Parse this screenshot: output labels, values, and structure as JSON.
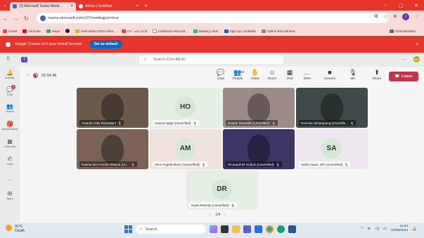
{
  "browser": {
    "tabs": [
      {
        "label": "(3) Microsoft Teams Meeti...",
        "active": true
      },
      {
        "label": "Admin | SertiNaxi",
        "active": false
      }
    ],
    "url": "teams.microsoft.com/v2/?meetingjoin=true",
    "bookmarks": [
      "Gmail",
      "YouTube",
      "Maps",
      "Rekrutmen SSDI Infos...",
      "CV - vcc.co.id",
      "Indofood e-Recruit...",
      "Mading Loker",
      "Sign Up | LinkedIn",
      "Online Recruitment..."
    ],
    "all_bookmarks": "All Bookmarks",
    "notice_text": "Google Chrome isn't your default browser",
    "notice_button": "Set as default"
  },
  "teams": {
    "search_placeholder": "Search (Ctrl+Alt+E)",
    "rail": [
      {
        "label": "Activity"
      },
      {
        "label": "Chat",
        "badge": "3"
      },
      {
        "label": "Teams"
      },
      {
        "label": "Assignments"
      },
      {
        "label": "Calendar"
      },
      {
        "label": "Calls"
      },
      {
        "label": "..."
      },
      {
        "label": "Apps"
      }
    ],
    "meeting": {
      "timer": "02:54:48",
      "controls": [
        {
          "label": "Chat",
          "icon": "chat-icon",
          "glyph": "💬"
        },
        {
          "label": "People",
          "icon": "people-icon",
          "glyph": "👥",
          "count": "33"
        },
        {
          "label": "Raise",
          "icon": "hand-icon",
          "glyph": "✋"
        },
        {
          "label": "React",
          "icon": "smile-icon",
          "glyph": "☺"
        },
        {
          "label": "View",
          "icon": "grid-icon",
          "glyph": "▦"
        },
        {
          "label": "More",
          "icon": "more-icon",
          "glyph": "…"
        },
        {
          "label": "Camera",
          "icon": "camera-icon",
          "glyph": "■"
        },
        {
          "label": "Mic",
          "icon": "mic-icon",
          "glyph": "🎙"
        },
        {
          "label": "Share",
          "icon": "share-icon",
          "glyph": "⬆"
        }
      ],
      "leave_label": "Leave",
      "participants": [
        {
          "name": "Ananda Gitty Ramadani",
          "initials": "",
          "bg": "#6b5a4a",
          "dark": true
        },
        {
          "name": "Hanick Odge (Unverified)",
          "initials": "HO",
          "bg": "#e6efe3"
        },
        {
          "name": "Despin Zaauddin (Unverified)",
          "initials": "",
          "bg": "#9b8a86",
          "dark": true
        },
        {
          "name": "Revinka Simatupang (Unverifie...",
          "initials": "",
          "bg": "#3f4a4a",
          "dark": true
        },
        {
          "name": "Rasma Nur Amelia Oktavia (Un...",
          "initials": "",
          "bg": "#7a6257",
          "dark": true
        },
        {
          "name": "Alice Angela Marici (Unverified)",
          "initials": "AM",
          "bg": "#efe3dc"
        },
        {
          "name": "Ricmaulii Br Gultom (Unverified)",
          "initials": "",
          "bg": "#3d3566",
          "dark": true
        },
        {
          "name": "Saiful Anam, SPi (Unverified)",
          "initials": "SA",
          "bg": "#efe7f0"
        },
        {
          "name": "Davis Reendy (Unverified)",
          "initials": "DR",
          "bg": "#e6efe3"
        }
      ],
      "pager": "1/4"
    }
  },
  "taskbar": {
    "weather_temp": "31°C",
    "weather_desc": "Cerah",
    "search": "Search",
    "time": "11:54",
    "date": "07/06/2024"
  }
}
